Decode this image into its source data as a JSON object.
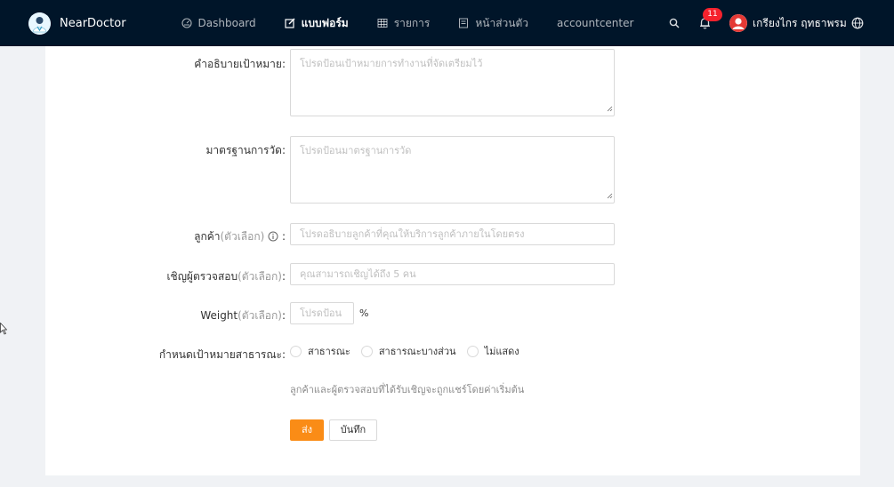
{
  "header": {
    "brand": "NearDoctor",
    "menu": [
      {
        "label": "Dashboard",
        "icon": "dashboard-icon"
      },
      {
        "label": "แบบฟอร์ม",
        "icon": "form-icon"
      },
      {
        "label": "รายการ",
        "icon": "table-icon"
      },
      {
        "label": "หน้าส่วนตัว",
        "icon": "profile-icon"
      },
      {
        "label": "accountcenter",
        "icon": ""
      }
    ],
    "notification_count": "11",
    "username": "เกรียงไกร ฤทธาพรม"
  },
  "form": {
    "goal_description": {
      "label": "คำอธิบายเป้าหมาย",
      "placeholder": "โปรดป้อนเป้าหมายการทำงานที่จัดเตรียมไว้"
    },
    "metrics": {
      "label": "มาตรฐานการวัด",
      "placeholder": "โปรดป้อนมาตรฐานการวัด"
    },
    "client": {
      "label": "ลูกค้า",
      "optional": "(ตัวเลือก)",
      "placeholder": "โปรดอธิบายลูกค้าที่คุณให้บริการลูกค้าภายในโดยตรง"
    },
    "invites": {
      "label": "เชิญผู้ตรวจสอบ",
      "optional": "(ตัวเลือก)",
      "placeholder": "คุณสามารถเชิญได้ถึง 5 คน"
    },
    "weight": {
      "label": "Weight",
      "optional": "(ตัวเลือก)",
      "placeholder": "โปรดป้อน",
      "unit": "%"
    },
    "public_target": {
      "label": "กำหนดเป้าหมายสาธารณะ",
      "options": [
        "สาธารณะ",
        "สาธารณะบางส่วน",
        "ไม่แสดง"
      ]
    },
    "hint": "ลูกค้าและผู้ตรวจสอบที่ได้รับเชิญจะถูกแชร์โดยค่าเริ่มต้น",
    "submit": "ส่ง",
    "save": "บันทึก"
  },
  "colors": {
    "header_bg": "#001529",
    "primary": "#fa8c16",
    "badge": "#f5222d"
  }
}
